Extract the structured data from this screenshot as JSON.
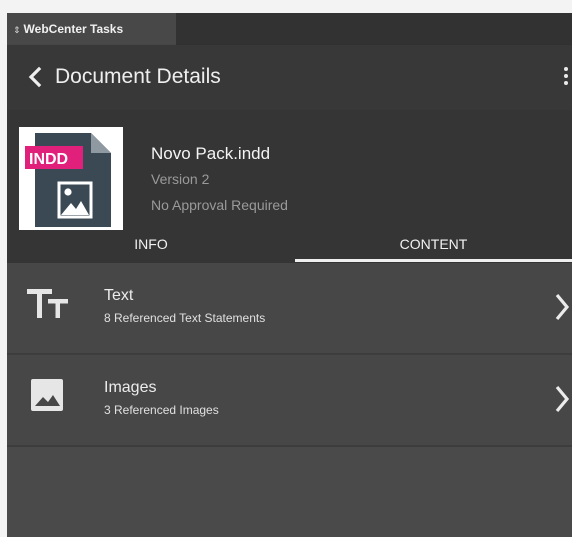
{
  "panel": {
    "tab_label": "WebCenter Tasks",
    "grip_icon": "expand-collapse-icon"
  },
  "header": {
    "title": "Document Details",
    "back_icon": "chevron-left-icon",
    "menu_icon": "kebab-menu-icon"
  },
  "document": {
    "badge": "INDD",
    "name": "Novo Pack.indd",
    "version": "Version 2",
    "approval": "No Approval Required",
    "thumbnail_icon": "image-file-icon"
  },
  "tabs": [
    {
      "label": "INFO",
      "active": false
    },
    {
      "label": "CONTENT",
      "active": true
    }
  ],
  "content_items": [
    {
      "title": "Text",
      "subtitle": "8 Referenced Text Statements",
      "icon": "text-size-icon"
    },
    {
      "title": "Images",
      "subtitle": "3 Referenced Images",
      "icon": "image-icon"
    }
  ],
  "colors": {
    "badge_bg": "#e0207b",
    "panel_bg": "#4a4a4a",
    "header_bg": "#383838"
  }
}
